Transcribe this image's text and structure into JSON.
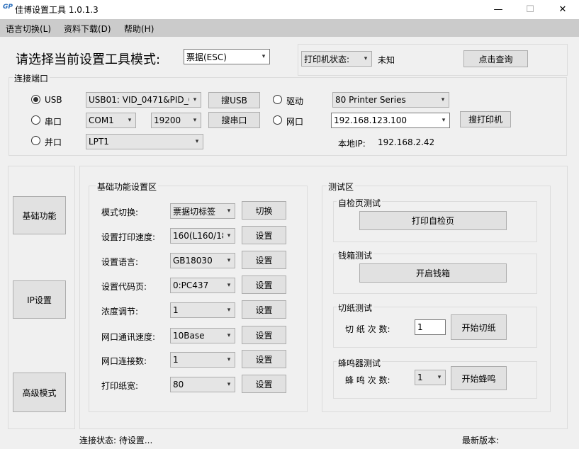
{
  "window": {
    "icon_text": "GP",
    "title": "佳博设置工具 1.0.1.3",
    "min": "—",
    "max": "☐",
    "close": "✕"
  },
  "menu": [
    "语言切换(L)",
    "资料下载(D)",
    "帮助(H)"
  ],
  "mode": {
    "label": "请选择当前设置工具模式:",
    "value": "票据(ESC)"
  },
  "printer_status": {
    "label": "打印机状态:",
    "value": "未知",
    "query_button": "点击查询"
  },
  "connection": {
    "group_label": "连接端口",
    "usb_label": "USB",
    "usb_value": "USB01: VID_0471&PID_0",
    "usb_search": "搜USB",
    "driver_label": "驱动",
    "driver_value": "80 Printer Series",
    "serial_label": "串口",
    "com_value": "COM1",
    "baud_value": "19200",
    "serial_search": "搜串口",
    "net_label": "网口",
    "ip_value": "192.168.123.100",
    "printer_search": "搜打印机",
    "parallel_label": "并口",
    "lpt_value": "LPT1",
    "local_ip_label": "本地IP:",
    "local_ip_value": "192.168.2.42"
  },
  "side_tabs": [
    "基础功能",
    "IP设置",
    "高级模式"
  ],
  "basic": {
    "group_label": "基础功能设置区",
    "rows": [
      {
        "label": "模式切换:",
        "value": "票据切标签",
        "button": "切换"
      },
      {
        "label": "设置打印速度:",
        "value": "160(L160/18",
        "button": "设置"
      },
      {
        "label": "设置语言:",
        "value": "GB18030",
        "button": "设置"
      },
      {
        "label": "设置代码页:",
        "value": "0:PC437",
        "button": "设置"
      },
      {
        "label": "浓度调节:",
        "value": "1",
        "button": "设置"
      },
      {
        "label": "网口通讯速度:",
        "value": "10Base",
        "button": "设置"
      },
      {
        "label": "网口连接数:",
        "value": "1",
        "button": "设置"
      },
      {
        "label": "打印纸宽:",
        "value": "80",
        "button": "设置"
      }
    ]
  },
  "test": {
    "group_label": "测试区",
    "selftest_label": "自检页测试",
    "selftest_button": "打印自检页",
    "cashbox_label": "钱箱测试",
    "cashbox_button": "开启钱箱",
    "cut_label": "切纸测试",
    "cut_count_label": "切 纸 次 数:",
    "cut_count_value": "1",
    "cut_button": "开始切纸",
    "buzzer_label": "蜂鸣器测试",
    "buzzer_count_label": "蜂 鸣 次 数:",
    "buzzer_count_value": "1",
    "buzzer_button": "开始蜂鸣"
  },
  "status_bar": {
    "connection_status": "连接状态: 待设置...",
    "latest_version": "最新版本:"
  }
}
